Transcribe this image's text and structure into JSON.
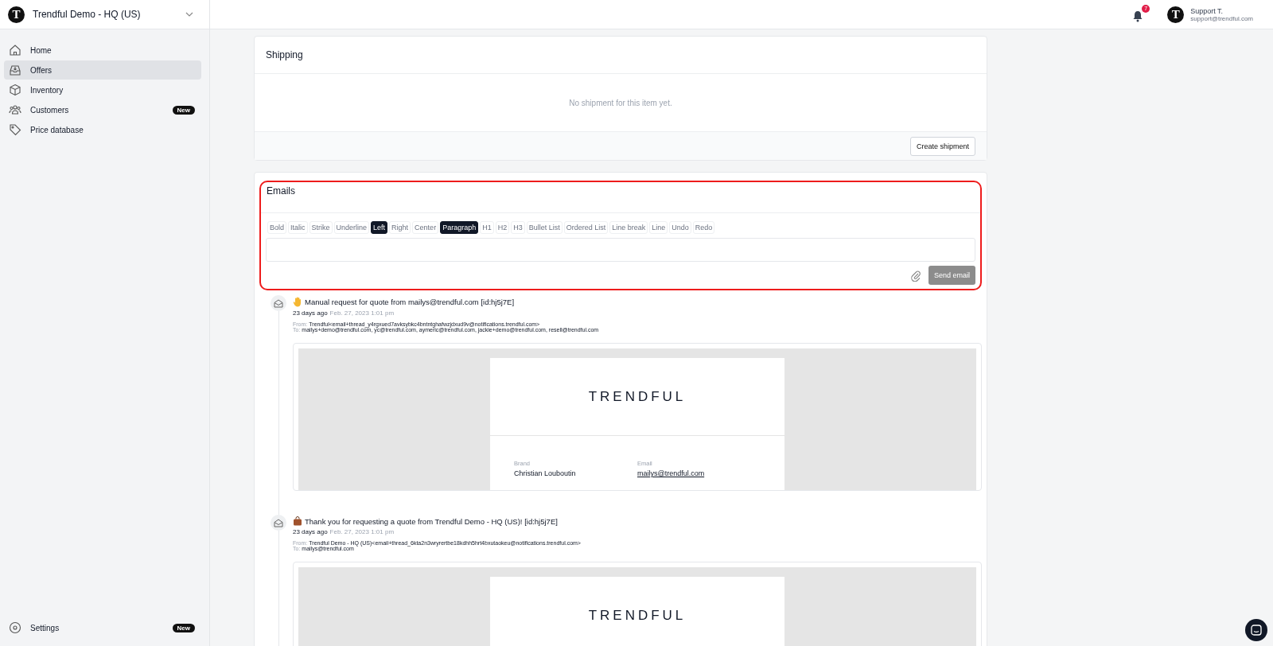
{
  "workspace": {
    "logo_letter": "T",
    "name": "Trendful Demo - HQ (US)"
  },
  "sidebar": {
    "items": [
      {
        "label": "Home",
        "selected": false
      },
      {
        "label": "Offers",
        "selected": true
      },
      {
        "label": "Inventory",
        "selected": false
      },
      {
        "label": "Customers",
        "selected": false,
        "badge": "New"
      },
      {
        "label": "Price database",
        "selected": false
      }
    ],
    "footer": {
      "label": "Settings",
      "badge": "New"
    }
  },
  "topbar": {
    "notifications": "7",
    "user": {
      "avatar_letter": "T",
      "name": "Support T.",
      "email": "support@trendful.com"
    }
  },
  "shipping": {
    "title": "Shipping",
    "empty_text": "No shipment for this item yet.",
    "button": "Create shipment"
  },
  "emails_panel": {
    "title": "Emails",
    "highlighted": true,
    "toolbar": [
      {
        "label": "Bold",
        "selected": false
      },
      {
        "label": "Italic",
        "selected": false
      },
      {
        "label": "Strike",
        "selected": false
      },
      {
        "label": "Underline",
        "selected": false
      },
      {
        "label": "Left",
        "selected": true
      },
      {
        "label": "Right",
        "selected": false
      },
      {
        "label": "Center",
        "selected": false
      },
      {
        "label": "Paragraph",
        "selected": true
      },
      {
        "label": "H1",
        "selected": false
      },
      {
        "label": "H2",
        "selected": false
      },
      {
        "label": "H3",
        "selected": false
      },
      {
        "label": "Bullet List",
        "selected": false
      },
      {
        "label": "Ordered List",
        "selected": false
      },
      {
        "label": "Line break",
        "selected": false
      },
      {
        "label": "Line",
        "selected": false
      },
      {
        "label": "Undo",
        "selected": false
      },
      {
        "label": "Redo",
        "selected": false
      }
    ],
    "send_button": {
      "label": "Send email",
      "disabled": true
    }
  },
  "emails": [
    {
      "kind": "request",
      "subject": "Manual request for quote from mailys@trendful.com [id:hj5j7E]",
      "relative_time": "23 days ago",
      "date": "Feb. 27, 2023 1:01 pm",
      "from_label": "From:",
      "from": "Trendful<email+thread_y4rgxued7avksybkc4bntntghafwzjdxud9v@notifications.trendful.com>",
      "to_label": "To:",
      "to": "mailys+demo@trendful.com, yc@trendful.com, aymeric@trendful.com, jackie+demo@trendful.com, resell@trendful.com",
      "preview": {
        "logo": "TRENDFUL",
        "fields": [
          {
            "label": "Brand",
            "value": "Christian Louboutin",
            "kind": "text"
          },
          {
            "label": "Email",
            "value": "mailys@trendful.com",
            "kind": "link"
          }
        ]
      }
    },
    {
      "kind": "confirmation",
      "subject": "Thank you for requesting a quote from Trendful Demo - HQ (US)! [id:hj5j7E]",
      "relative_time": "23 days ago",
      "date": "Feb. 27, 2023 1:01 pm",
      "from_label": "From:",
      "from": "Trendful Demo - HQ (US)<email+thread_6kta2n3wryrertbe18kdhh5hrt4bxutaokeu@notifications.trendful.com>",
      "to_label": "To:",
      "to": "mailys@trendful.com",
      "preview": {
        "logo": "TRENDFUL"
      }
    }
  ]
}
